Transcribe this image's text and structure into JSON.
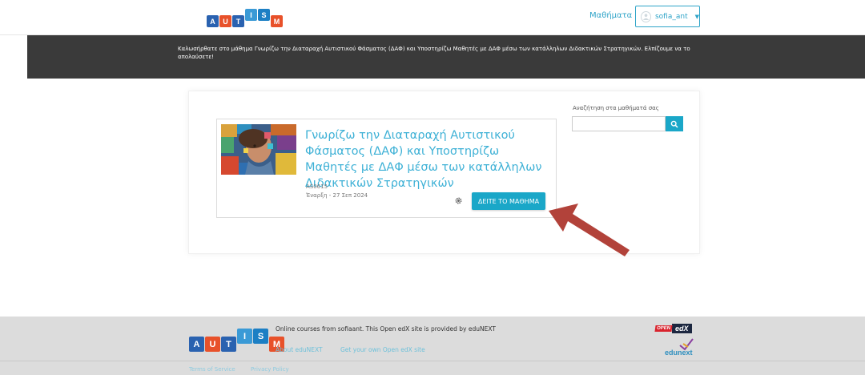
{
  "header": {
    "logo_letters": [
      "A",
      "U",
      "T",
      "I",
      "S",
      "M"
    ],
    "nav_courses": "Μαθήματα",
    "username": "sofia_ant"
  },
  "banner": {
    "text": "Καλωσήρθατε στο μάθημα Γνωρίζω την Διαταραχή Αυτιστικού Φάσματος (ΔΑΦ) και Υποστηρίζω Μαθητές με ΔΑΦ μέσω των κατάλληλων Διδακτικών Στρατηγικών. Ελπίζουμε να το απολαύσετε!"
  },
  "course": {
    "title": "Γνωρίζω την Διαταραχή Αυτιστικού Φάσματος (ΔΑΦ) και Υποστηρίζω Μαθητές με ΔΑΦ μέσω των κατάλληλων Διδακτικών Στρατηγικών",
    "code": "AS0615",
    "start": "Έναρξη - 27 Σεπ 2024",
    "view_button": "ΔΕΙΤΕ ΤΟ ΜΑΘΗΜΑ"
  },
  "search": {
    "label": "Αναζήτηση στα μαθήματά σας",
    "value": "",
    "placeholder": ""
  },
  "footer": {
    "text": "Online courses from sofiaant. This Open edX site is provided by eduNEXT",
    "link_about": "About eduNEXT",
    "link_get": "Get your own Open edX site",
    "terms": "Terms of Service",
    "privacy": "Privacy Policy",
    "badge_open": "OPEN",
    "badge_edx": "edX",
    "edunext": "edunext"
  },
  "colors": {
    "accent": "#1aa7c8",
    "link": "#3eb1d6",
    "banner_bg": "#3a3a3a",
    "footer_bg": "#dcdcdc",
    "arrow": "#b2423a"
  }
}
